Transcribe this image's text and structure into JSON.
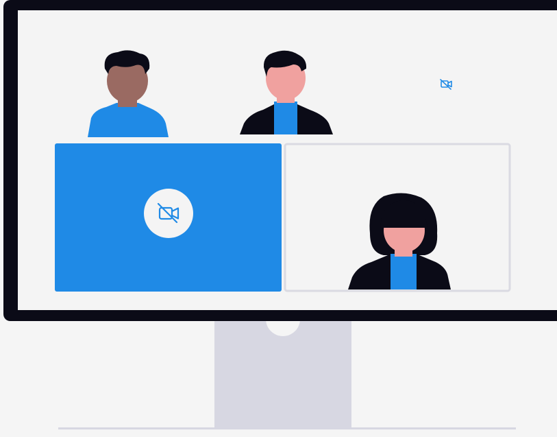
{
  "illustration": {
    "subject": "video-conference",
    "colors": {
      "background": "#f5f5f5",
      "monitor_frame": "#0b0b17",
      "screen": "#f4f4f4",
      "stand": "#d7d7e2",
      "floor_line": "#d7d7e2",
      "accent_blue": "#1f8ae6",
      "skin_light": "#f0a19f",
      "skin_dark": "#9a6a62",
      "hair": "#0b0b17",
      "tile_border": "#dadae2",
      "icon_circle": "#f4f4f4"
    },
    "icons": {
      "camera_off_small": "video-camera-off-icon",
      "camera_off_large": "video-camera-off-icon"
    },
    "participants": [
      {
        "role": "participant",
        "camera": "on",
        "skin": "dark"
      },
      {
        "role": "participant",
        "camera": "on",
        "skin": "light"
      },
      {
        "role": "participant",
        "camera": "off"
      },
      {
        "role": "participant",
        "camera": "off"
      },
      {
        "role": "participant",
        "camera": "on",
        "skin": "light"
      }
    ]
  }
}
